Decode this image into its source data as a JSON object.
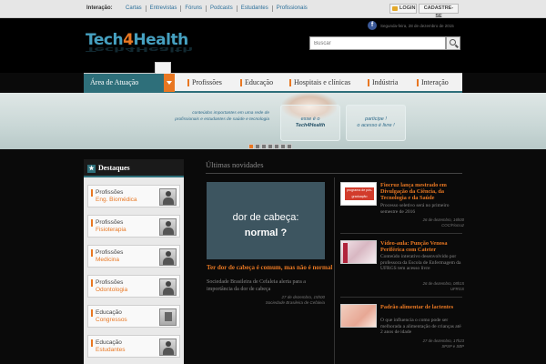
{
  "topbar": {
    "lead": "Interação:",
    "links": [
      "Cartas",
      "Entrevistas",
      "Fóruns",
      "Podcasts",
      "Estudantes",
      "Profissionais"
    ],
    "login_label": "LOGIN",
    "signup_label": "CADASTRE-SE"
  },
  "header": {
    "logo_part1": "Tech",
    "logo_part2": "4",
    "logo_part3": "Health",
    "date": "Segunda-feira, 28 de dezembro de 2015",
    "search_placeholder": "Buscar"
  },
  "nav": {
    "area_label": "Área de Atuação",
    "items": [
      "Profissões",
      "Educação",
      "Hospitais e clínicas",
      "Indústria",
      "Interação"
    ]
  },
  "banner": {
    "text1": "conteúdos importantes em uma rede de profissionais e estudantes de saúde e tecnologia",
    "text2_pre": "esse é o",
    "text2_brand": "Tech4Health",
    "text3_pre": "participe !",
    "text3_post": "o acesso é livre !"
  },
  "sidebar": {
    "title": "Destaques",
    "items": [
      {
        "category": "Profissões",
        "sub": "Eng. Biomédica"
      },
      {
        "category": "Profissões",
        "sub": "Fisioterapia"
      },
      {
        "category": "Profissões",
        "sub": "Medicina"
      },
      {
        "category": "Profissões",
        "sub": "Odontologia"
      },
      {
        "category": "Educação",
        "sub": "Congressos"
      },
      {
        "category": "Educação",
        "sub": "Estudantes"
      }
    ]
  },
  "content": {
    "title": "Últimas novidades",
    "feature": {
      "image_line1": "dor de cabeça:",
      "image_line2": "normal ?",
      "title": "Ter dor de cabeça é comum, mas não é normal",
      "desc": "Sociedade Brasileira de Cefaleia alerta para a importância da dor de cabeça",
      "meta_date": "27 de dezembro, 15h00",
      "meta_source": "Sociedade Brasileira de Cefaleia"
    },
    "news": [
      {
        "thumb_text": "programa de pós-graduação",
        "title": "Fiocruz lança mestrado em Divulgação da Ciência, da Tecnologia e da Saúde",
        "desc": "Processo seletivo será no primeiro semestre de 2016",
        "meta_date": "26 de dezembro, 16h00",
        "meta_source": "COC/Fiocruz"
      },
      {
        "title": "Vídeo-aula: Punção Venosa Periférica com Cateter",
        "desc": "Conteúdo interativo desenvolvido por professora da Escola de Enfermagem da UFRGS tem acesso livre",
        "meta_date": "26 de dezembro, 08h15",
        "meta_source": "UFRGS"
      },
      {
        "title": "Padrão alimentar de lactentes",
        "desc": "O que influencia o como pode ser melhorada a alimentação de crianças até 2 anos de idade",
        "meta_date": "27 de dezembro, 17h23",
        "meta_source": "SPSP e SBP"
      }
    ]
  },
  "colors": {
    "accent": "#e87722",
    "teal": "#2e6f7a",
    "link": "#2b6f9a"
  }
}
